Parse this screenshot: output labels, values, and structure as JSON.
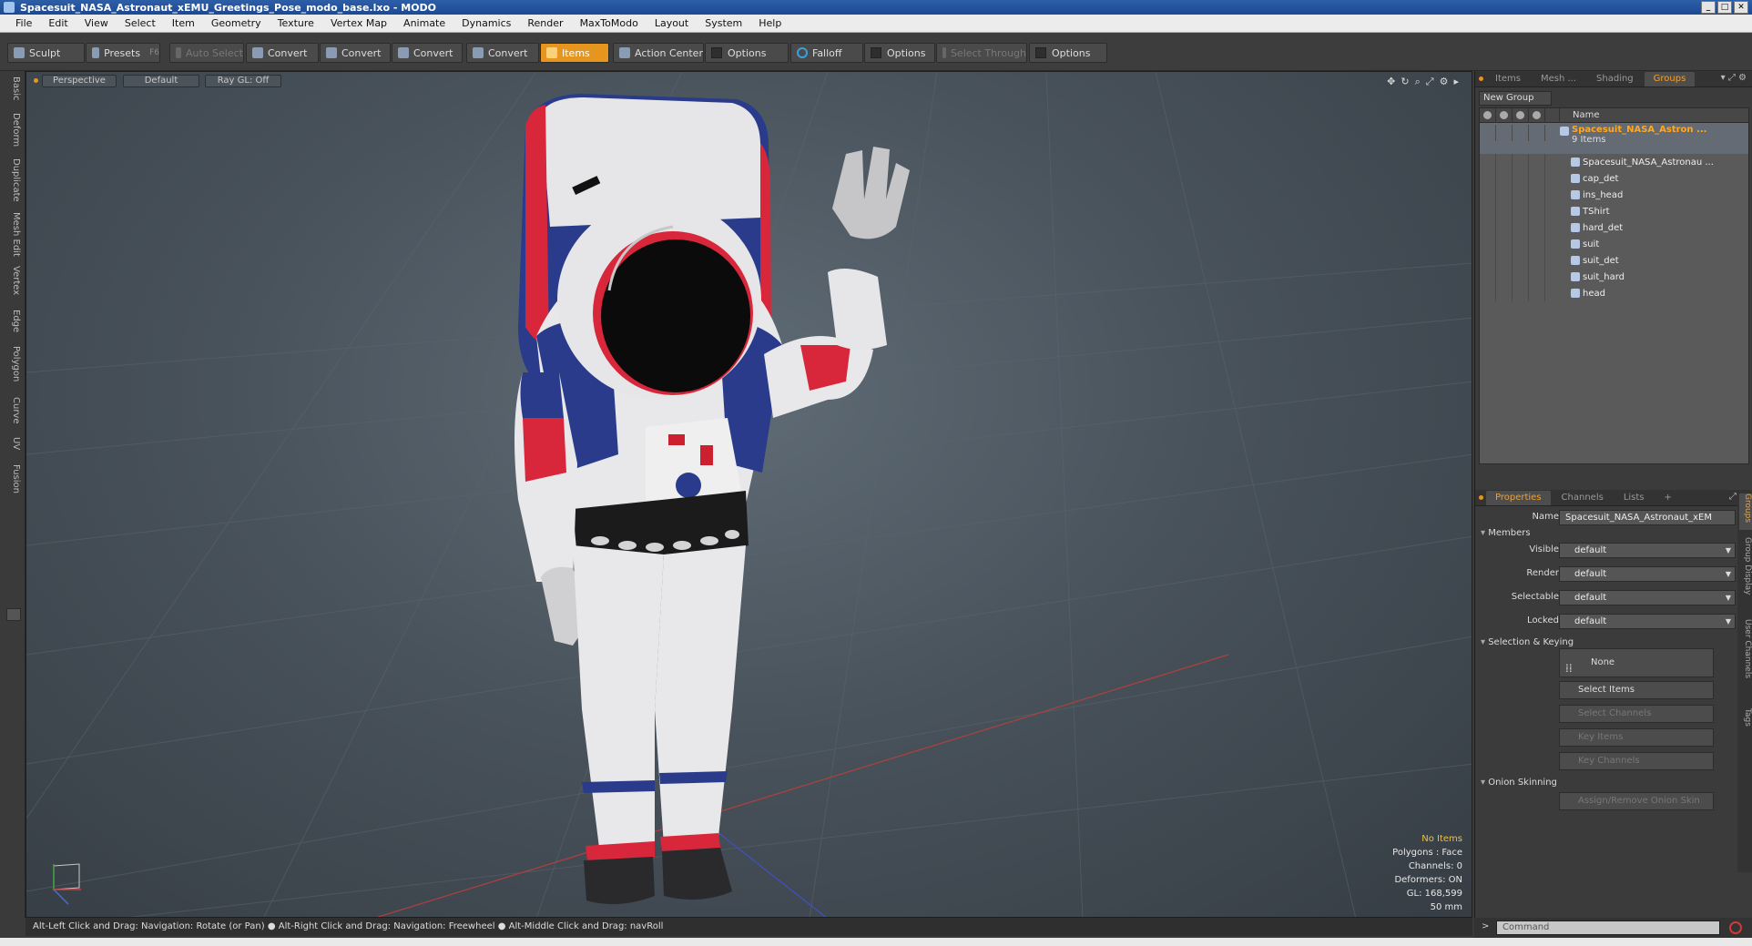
{
  "window": {
    "title": "Spacesuit_NASA_Astronaut_xEMU_Greetings_Pose_modo_base.lxo - MODO"
  },
  "menu": [
    "File",
    "Edit",
    "View",
    "Select",
    "Item",
    "Geometry",
    "Texture",
    "Vertex Map",
    "Animate",
    "Dynamics",
    "Render",
    "MaxToModo",
    "Layout",
    "System",
    "Help"
  ],
  "toolbar": {
    "sculpt": "Sculpt",
    "presets": "Presets",
    "presets_key": "F6",
    "auto_select": "Auto Select",
    "convert1": "Convert",
    "convert2": "Convert",
    "convert3": "Convert",
    "convert4": "Convert",
    "items": "Items",
    "action_center": "Action Center",
    "options1": "Options",
    "falloff": "Falloff",
    "options2": "Options",
    "select_through": "Select Through",
    "options3": "Options"
  },
  "left_tabs": [
    "Basic",
    "Deform",
    "Duplicate",
    "Mesh Edit",
    "Vertex",
    "Edge",
    "Polygon",
    "Curve",
    "UV",
    "Fusion"
  ],
  "viewport": {
    "view": "Perspective",
    "shading": "Default",
    "raygl": "Ray GL: Off",
    "stats": {
      "selection": "No Items",
      "polygons": "Polygons : Face",
      "channels": "Channels: 0",
      "deformers": "Deformers: ON",
      "gl": "GL: 168,599",
      "unit": "50 mm"
    },
    "colors": {
      "suit_white": "#e8e8ea",
      "suit_blue": "#2a3b8c",
      "suit_red": "#d8263a",
      "visor": "#0b0b0c",
      "belt": "#1b1b1b"
    }
  },
  "panel": {
    "tabs": [
      "Items",
      "Mesh ...",
      "Shading",
      "Groups"
    ],
    "active_tab": "Groups",
    "new_group": "New Group",
    "name_col": "Name",
    "group": {
      "name": "Spacesuit_NASA_Astron ...",
      "count": "9 Items"
    },
    "items": [
      "Spacesuit_NASA_Astronau ...",
      "cap_det",
      "ins_head",
      "TShirt",
      "hard_det",
      "suit",
      "suit_det",
      "suit_hard",
      "head"
    ]
  },
  "props": {
    "tabs": [
      "Properties",
      "Channels",
      "Lists",
      "+"
    ],
    "name_label": "Name",
    "name_value": "Spacesuit_NASA_Astronaut_xEM",
    "members": "Members",
    "visible_label": "Visible",
    "visible": "default",
    "render_label": "Render",
    "render": "default",
    "selectable_label": "Selectable",
    "selectable": "default",
    "locked_label": "Locked",
    "locked": "default",
    "selection_keying": "Selection & Keying",
    "none_btn": "None",
    "select_items": "Select Items",
    "select_channels": "Select Channels",
    "key_items": "Key Items",
    "key_channels": "Key Channels",
    "onion": "Onion Skinning",
    "assign_onion": "Assign/Remove Onion Skin",
    "side_tabs": [
      "Groups",
      "Group Display",
      "User Channels",
      "Tags"
    ]
  },
  "status": {
    "hint1": "Alt-Left Click and Drag: Navigation: Rotate (or Pan)",
    "hint2": "Alt-Right Click and Drag: Navigation: Freewheel",
    "hint3": "Alt-Middle Click and Drag: navRoll"
  },
  "command": {
    "placeholder": "Command"
  }
}
